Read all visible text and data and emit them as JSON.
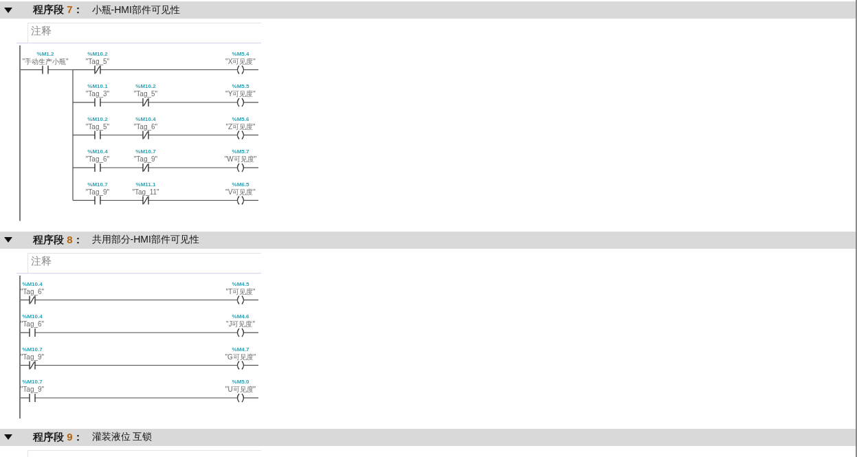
{
  "networks": [
    {
      "label": "程序段",
      "number": "7",
      "colon": "：",
      "title": "小瓶-HMI部件可见性",
      "expanded": true,
      "comment": {
        "placeholder": "注释"
      },
      "rungs": [
        {
          "contacts": [
            {
              "kind": "no",
              "address": "%M1.2",
              "tag": "\"手动生产小瓶\""
            }
          ],
          "branches": [
            {
              "contacts": [
                {
                  "kind": "nc",
                  "address": "%M10.2",
                  "tag": "\"Tag_5\""
                }
              ],
              "coil": {
                "address": "%M5.4",
                "tag": "\"X可见度\""
              }
            },
            {
              "contacts": [
                {
                  "kind": "no",
                  "address": "%M10.1",
                  "tag": "\"Tag_3\""
                },
                {
                  "kind": "nc",
                  "address": "%M10.2",
                  "tag": "\"Tag_5\""
                }
              ],
              "coil": {
                "address": "%M5.5",
                "tag": "\"Y可见度\""
              }
            },
            {
              "contacts": [
                {
                  "kind": "no",
                  "address": "%M10.2",
                  "tag": "\"Tag_5\""
                },
                {
                  "kind": "nc",
                  "address": "%M10.4",
                  "tag": "\"Tag_6\""
                }
              ],
              "coil": {
                "address": "%M5.6",
                "tag": "\"Z可见度\""
              }
            },
            {
              "contacts": [
                {
                  "kind": "no",
                  "address": "%M10.4",
                  "tag": "\"Tag_6\""
                },
                {
                  "kind": "nc",
                  "address": "%M10.7",
                  "tag": "\"Tag_9\""
                }
              ],
              "coil": {
                "address": "%M5.7",
                "tag": "\"W可见度\""
              }
            },
            {
              "contacts": [
                {
                  "kind": "no",
                  "address": "%M10.7",
                  "tag": "\"Tag_9\""
                },
                {
                  "kind": "nc",
                  "address": "%M11.1",
                  "tag": "\"Tag_11\""
                }
              ],
              "coil": {
                "address": "%M6.5",
                "tag": "\"V可见度\""
              }
            }
          ]
        }
      ]
    },
    {
      "label": "程序段",
      "number": "8",
      "colon": "：",
      "title": "共用部分-HMI部件可见性",
      "expanded": true,
      "comment": {
        "placeholder": "注释"
      },
      "rungs": [
        {
          "contacts": [
            {
              "kind": "nc",
              "address": "%M10.4",
              "tag": "\"Tag_6\""
            }
          ],
          "coil": {
            "address": "%M4.5",
            "tag": "\"T可见度\""
          }
        },
        {
          "contacts": [
            {
              "kind": "no",
              "address": "%M10.4",
              "tag": "\"Tag_6\""
            }
          ],
          "coil": {
            "address": "%M4.6",
            "tag": "\"J可见度\""
          }
        },
        {
          "contacts": [
            {
              "kind": "nc",
              "address": "%M10.7",
              "tag": "\"Tag_9\""
            }
          ],
          "coil": {
            "address": "%M4.7",
            "tag": "\"G可见度\""
          }
        },
        {
          "contacts": [
            {
              "kind": "no",
              "address": "%M10.7",
              "tag": "\"Tag_9\""
            }
          ],
          "coil": {
            "address": "%M5.0",
            "tag": "\"U可见度\""
          }
        }
      ]
    },
    {
      "label": "程序段",
      "number": "9",
      "colon": "：",
      "title": "灌装液位 互锁",
      "expanded": true
    }
  ]
}
